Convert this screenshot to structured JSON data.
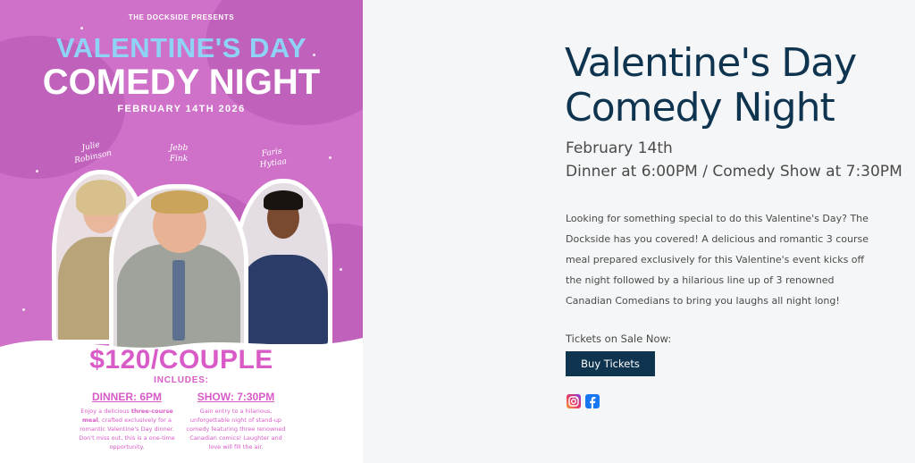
{
  "poster": {
    "presents": "THE DOCKSIDE PRESENTS",
    "title_line1": "VALENTINE'S DAY",
    "title_line2": "COMEDY NIGHT",
    "date": "FEBRUARY 14TH 2026",
    "comedians": [
      {
        "first": "Julie",
        "last": "Robinson"
      },
      {
        "first": "Jebb",
        "last": "Fink"
      },
      {
        "first": "Faris",
        "last": "Hytiaa"
      }
    ],
    "price": "$120/COUPLE",
    "includes": "INCLUDES:",
    "dinner_heading": "DINNER: 6PM",
    "dinner_text_a": "Enjoy a delicious ",
    "dinner_text_bold": "three-course meal",
    "dinner_text_b": ", crafted exclusively for a romantic Valentine's Day dinner. Don't miss out, this is a one-time opportunity.",
    "show_heading": "SHOW: 7:30PM",
    "show_text": "Gain entry to a hilarious, unforgettable night of stand-up comedy featuring three renowned Canadian comics! Laughter and love will fill the air."
  },
  "event": {
    "title_line1": "Valentine's Day",
    "title_line2": "Comedy Night",
    "date": "February 14th",
    "times": "Dinner at 6:00PM / Comedy Show at 7:30PM",
    "description": "Looking for something special to do this Valentine's Day? The Dockside has you covered! A delicious and romantic 3 course meal prepared exclusively for this Valentine's event kicks off the night followed by a hilarious line up of 3 renowned Canadian Comedians to bring you laughs all night long!",
    "tickets_label": "Tickets on Sale Now:",
    "buy_button": "Buy Tickets"
  },
  "social": {
    "icons": [
      "instagram-icon",
      "facebook-icon"
    ]
  },
  "colors": {
    "poster_bg": "#cf71c9",
    "poster_accent": "#d85bc7",
    "title_blue": "#8fd3f4",
    "heading_navy": "#0f344f",
    "body_text": "#4a4a4a",
    "page_bg": "#f5f6f7"
  }
}
